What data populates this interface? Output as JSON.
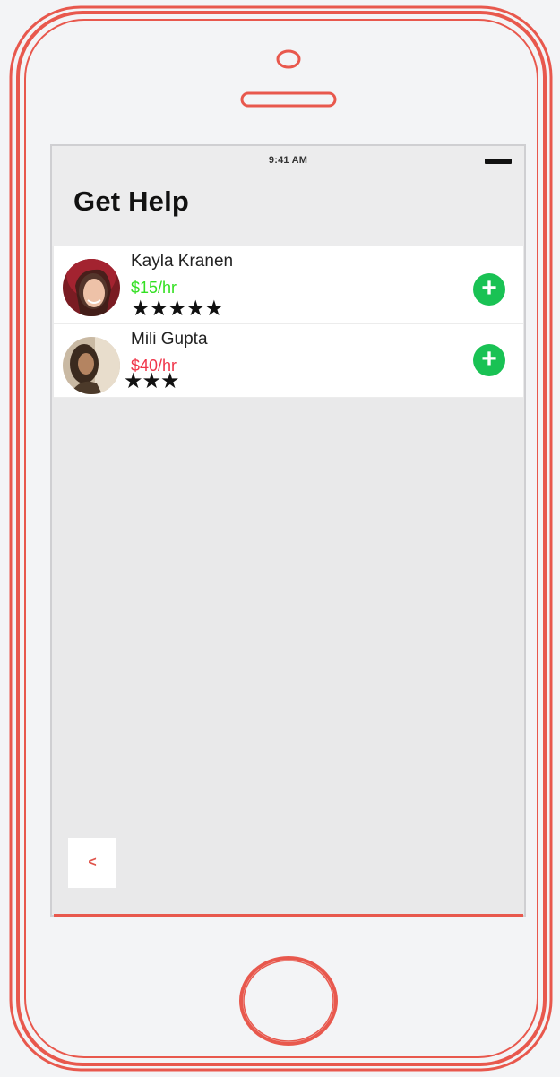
{
  "status_bar": {
    "time": "9:41 AM"
  },
  "header": {
    "title": "Get Help"
  },
  "helpers": [
    {
      "name": "Kayla Kranen",
      "rate": "$15/hr",
      "rate_color": "#33e022",
      "rating_stars": "★★★★★",
      "rating": 5
    },
    {
      "name": "Mili Gupta",
      "rate": "$40/hr",
      "rate_color": "#f0364a",
      "rating_stars": "★★★",
      "rating": 3
    }
  ],
  "back_button": {
    "label": "<"
  },
  "colors": {
    "phone_outline": "#e8584d",
    "add_button": "#19c254",
    "screen_bg": "#e9e9ea"
  },
  "icons": {
    "add": "plus-circle-icon"
  }
}
